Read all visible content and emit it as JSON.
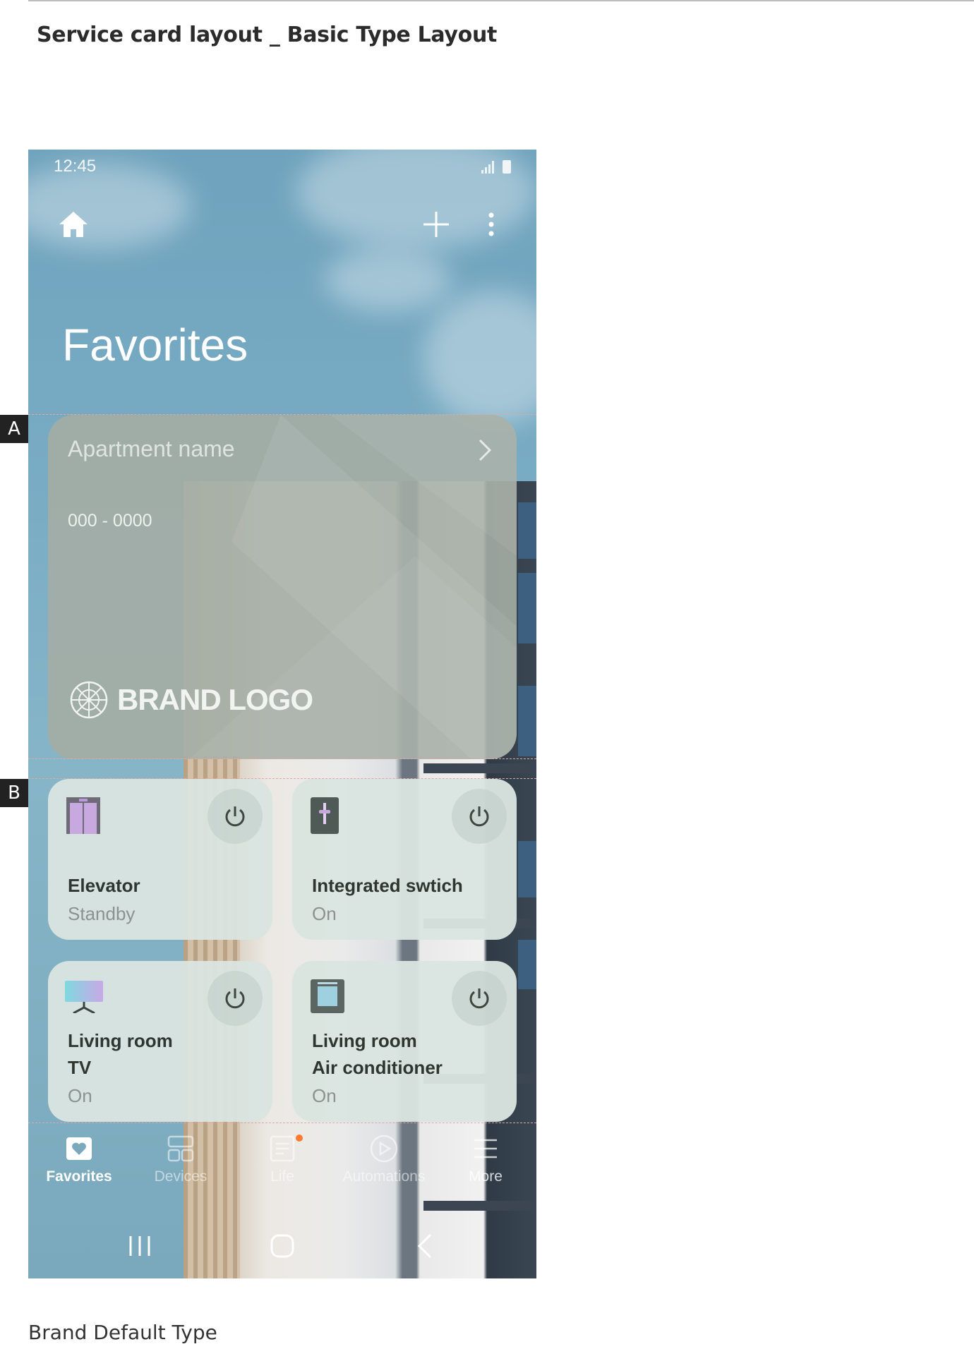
{
  "document": {
    "title": "Service card layout _ Basic Type Layout",
    "caption": "Brand Default Type",
    "markers": [
      "A",
      "B"
    ]
  },
  "phone": {
    "status_bar": {
      "time": "12:45"
    },
    "header": {
      "title": "Favorites"
    },
    "service_card": {
      "apartment_name": "Apartment name",
      "number": "000 - 0000",
      "brand_logo": "BRAND LOGO"
    },
    "devices": [
      {
        "name": "Elevator",
        "status": "Standby",
        "icon": "elevator-icon"
      },
      {
        "name": "Integrated swtich",
        "status": "On",
        "icon": "switch-icon"
      },
      {
        "name_line1": "Living room",
        "name_line2": "TV",
        "status": "On",
        "icon": "tv-icon"
      },
      {
        "name_line1": "Living room",
        "name_line2": "Air conditioner",
        "status": "On",
        "icon": "air-conditioner-icon"
      }
    ],
    "bottom_nav": [
      {
        "label": "Favorites",
        "active": true
      },
      {
        "label": "Devices",
        "active": false
      },
      {
        "label": "Life",
        "active": false
      },
      {
        "label": "Automations",
        "active": false
      },
      {
        "label": "More",
        "active": false
      }
    ]
  }
}
